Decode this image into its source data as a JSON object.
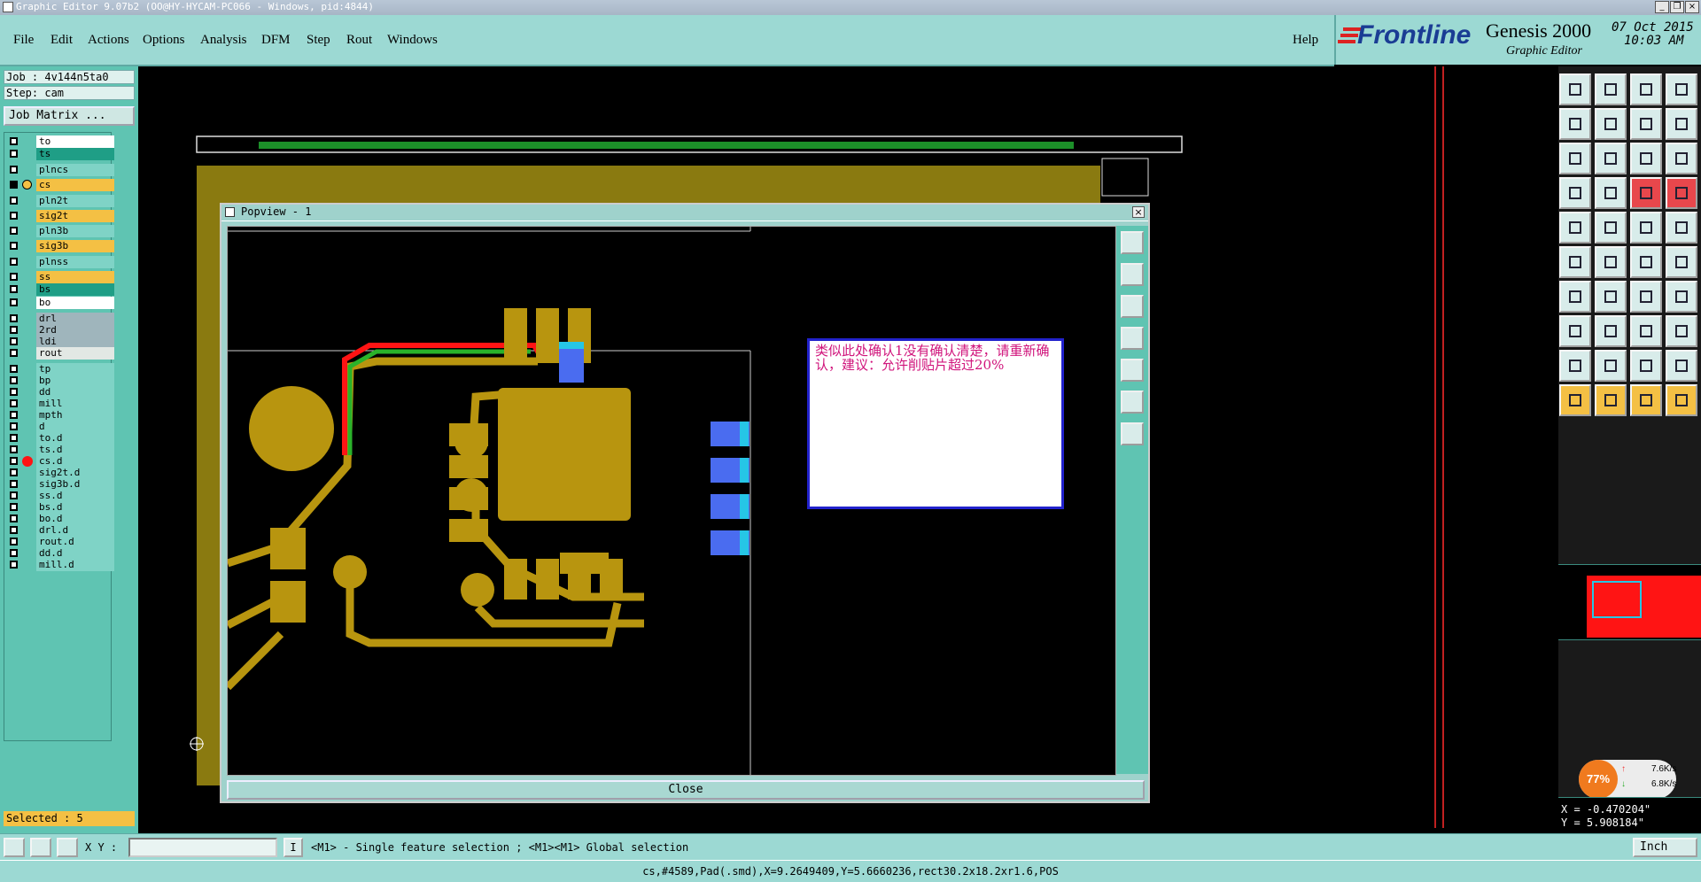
{
  "window": {
    "title": "Graphic Editor 9.07b2 (OO@HY-HYCAM-PC066 - Windows, pid:4844)"
  },
  "menu": {
    "items": [
      "File",
      "Edit",
      "Actions",
      "Options",
      "Analysis",
      "DFM",
      "Step",
      "Rout",
      "Windows"
    ],
    "help": "Help"
  },
  "brand": {
    "logo": "Frontline",
    "product": "Genesis 2000",
    "subtitle": "Graphic Editor",
    "date": "07 Oct 2015",
    "time": "10:03 AM"
  },
  "job": {
    "job_line": "Job : 4v144n5ta0",
    "step_line": "Step: cam",
    "matrix_button": "Job Matrix ..."
  },
  "layers": [
    {
      "name": "to",
      "color": "#ffffff"
    },
    {
      "name": "ts",
      "color": "#1f9e86"
    },
    {
      "name": "plncs",
      "color": "#7fd3c6"
    },
    {
      "name": "cs",
      "color": "#f4c044",
      "active": true
    },
    {
      "name": "pln2t",
      "color": "#7fd3c6"
    },
    {
      "name": "sig2t",
      "color": "#f4c044"
    },
    {
      "name": "pln3b",
      "color": "#7fd3c6"
    },
    {
      "name": "sig3b",
      "color": "#f4c044"
    },
    {
      "name": "plnss",
      "color": "#7fd3c6"
    },
    {
      "name": "ss",
      "color": "#f4c044"
    },
    {
      "name": "bs",
      "color": "#1f9e86"
    },
    {
      "name": "bo",
      "color": "#ffffff"
    },
    {
      "name": "drl",
      "color": "#9fb5bc"
    },
    {
      "name": "2rd",
      "color": "#9fb5bc"
    },
    {
      "name": "ldi",
      "color": "#9fb5bc"
    },
    {
      "name": "rout",
      "color": "#e2e8e4"
    },
    {
      "name": "tp",
      "color": "#7fd3c6"
    },
    {
      "name": "bp",
      "color": "#7fd3c6"
    },
    {
      "name": "dd",
      "color": "#7fd3c6"
    },
    {
      "name": "mill",
      "color": "#7fd3c6"
    },
    {
      "name": "mpth",
      "color": "#7fd3c6"
    },
    {
      "name": "d",
      "color": "#7fd3c6"
    },
    {
      "name": "to.d",
      "color": "#7fd3c6"
    },
    {
      "name": "ts.d",
      "color": "#7fd3c6"
    },
    {
      "name": "cs.d",
      "color": "#7fd3c6",
      "marked": true
    },
    {
      "name": "sig2t.d",
      "color": "#7fd3c6"
    },
    {
      "name": "sig3b.d",
      "color": "#7fd3c6"
    },
    {
      "name": "ss.d",
      "color": "#7fd3c6"
    },
    {
      "name": "bs.d",
      "color": "#7fd3c6"
    },
    {
      "name": "bo.d",
      "color": "#7fd3c6"
    },
    {
      "name": "drl.d",
      "color": "#7fd3c6"
    },
    {
      "name": "rout.d",
      "color": "#7fd3c6"
    },
    {
      "name": "dd.d",
      "color": "#7fd3c6"
    },
    {
      "name": "mill.d",
      "color": "#7fd3c6"
    }
  ],
  "selected_text": "Selected : 5",
  "popview": {
    "title": "Popview - 1",
    "close_label": "Close"
  },
  "note": {
    "text": "类似此处确认1没有确认清楚，请重新确认，建议：允许削贴片超过20%"
  },
  "network_widget": {
    "percent": "77%",
    "up": "7.6K/s",
    "down": "6.8K/s"
  },
  "coords": {
    "x": "X = -0.470204\"",
    "y": "Y =  5.908184\""
  },
  "bottom": {
    "xy_label": "X Y :",
    "xy_value": "",
    "hint": "<M1> - Single feature selection ; <M1><M1> Global selection",
    "units": "Inch"
  },
  "status": {
    "text": "cs,#4589,Pad(.smd),X=9.2649409,Y=5.6660236,rect30.2x18.2xr1.6,POS"
  },
  "colors": {
    "copper": "#b8950f",
    "panel": "#9cd9d3",
    "accent": "#5fc4b2"
  }
}
